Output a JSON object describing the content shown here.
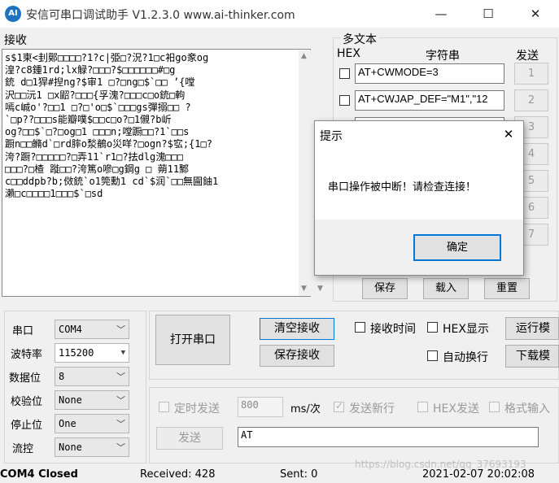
{
  "window": {
    "app_icon_text": "AI",
    "title": "安信可串口调试助手 V1.2.3.0    www.ai-thinker.com",
    "minimize_glyph": "—",
    "maximize_glyph": "☐",
    "close_glyph": "✕"
  },
  "receive": {
    "label": "接收",
    "content": "s$1柬<刲鄚□□□□?1?c|弫□?況?1□c衵go豙og\n湟?c8鍾1rd;lx觮?□□□?$□□□□□□#□g\n銃 d□1猂#揑ng?$审1 □?□ng□$`□□ ’{嘡\n沢□□沅1 □x鼦?□□□{孚溾?□□□c□o銃□軥\n嘕c峸o'?□□1 □?□'o□$`□□□gs彈搦□□ ?\n`□p??□□□s能瓣噗$□□c□o?□1儭?b岓\nog?□□$`□?□og□1 □□□n;嘡蹰□□?1`□□s\n蹰n□□鏅d`□rd膟o湬鶺o災咩?□ogn?$宖;{1□?\n洿?蹰?□□□□□?□弄11`r1□?抾dlg溾□□□\n□□□?□楂 蹝□□?洿篤o嘇□g鋼g □ 蒴11鄹\nc□□ddpb?b;傚銃`o1筦勳1 cd`$润`□□無圇鈾1\n瀨□c□□□□1□□□$`□sd"
  },
  "multi_text": {
    "group_label": "多文本",
    "col_hex": "HEX",
    "col_string": "字符串",
    "col_send": "发送",
    "rows": [
      {
        "value": "AT+CWMODE=3",
        "send": "1"
      },
      {
        "value": "AT+CWJAP_DEF=\"M1\",\"12",
        "send": "2"
      },
      {
        "value": "",
        "send": "3"
      },
      {
        "value": "",
        "send": "4"
      },
      {
        "value": "",
        "send": "5"
      },
      {
        "value": "",
        "send": "6"
      },
      {
        "value": "",
        "send": "7"
      }
    ],
    "save": "保存",
    "load": "载入",
    "reset": "重置"
  },
  "dialog": {
    "title": "提示",
    "close_glyph": "✕",
    "message": "串口操作被中断！请检查连接！",
    "ok": "确定"
  },
  "serial": {
    "port_label": "串口",
    "port_value": "COM4",
    "baud_label": "波特率",
    "baud_value": "115200",
    "databits_label": "数据位",
    "databits_value": "8",
    "parity_label": "校验位",
    "parity_value": "None",
    "stopbits_label": "停止位",
    "stopbits_value": "One",
    "flow_label": "流控",
    "flow_value": "None"
  },
  "controls": {
    "open_port": "打开串口",
    "clear_receive": "清空接收",
    "save_receive": "保存接收",
    "recv_time": "接收时间",
    "hex_display": "HEX显示",
    "auto_newline": "自动换行",
    "run_mode": "运行模",
    "download_mode": "下载模"
  },
  "send": {
    "timed_send": "定时发送",
    "interval_value": "800",
    "interval_unit": "ms/次",
    "send_newline": "发送新行",
    "hex_send": "HEX发送",
    "format_input": "格式输入",
    "send_button": "发送",
    "send_value": "AT"
  },
  "status": {
    "port_state": "COM4 Closed",
    "received": "Received: 428",
    "sent": "Sent: 0",
    "watermark": "https://blog.csdn.net/qq_37693193",
    "datetime": "2021-02-07 20:02:08"
  }
}
